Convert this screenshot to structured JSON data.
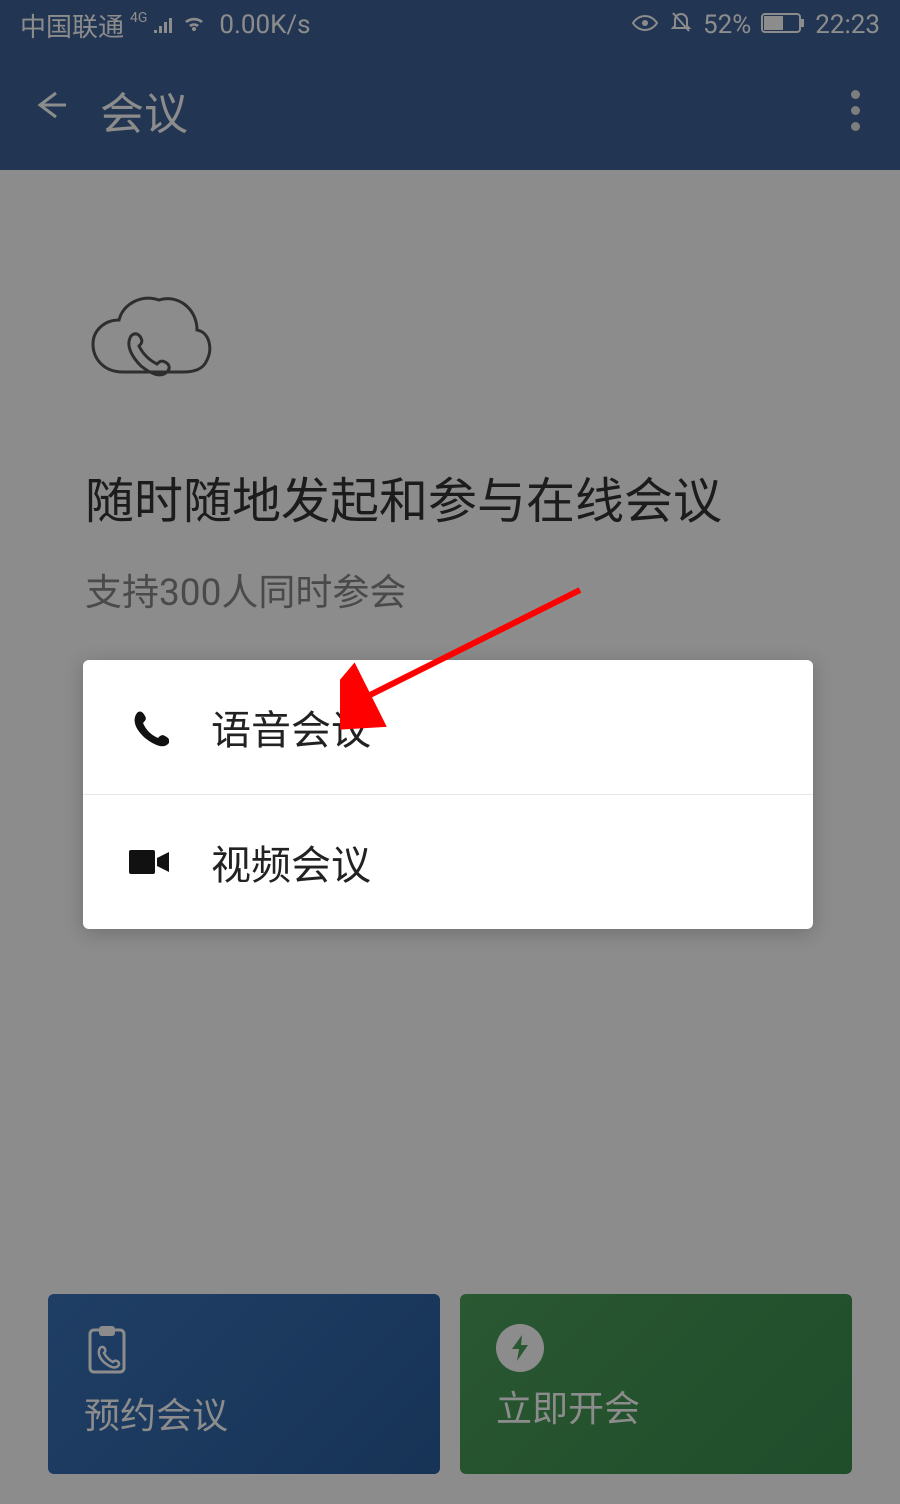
{
  "status_bar": {
    "carrier": "中国联通",
    "net_badge": "4G",
    "speed": "0.00K/s",
    "battery": "52%",
    "time": "22:23"
  },
  "app_bar": {
    "title": "会议"
  },
  "main": {
    "heading_line": "随时随地发起和参与在线会议",
    "sub": "支持300人同时参会"
  },
  "popup": {
    "voice": "语音会议",
    "video": "视频会议"
  },
  "cards": {
    "schedule": "预约会议",
    "instant": "立即开会"
  }
}
